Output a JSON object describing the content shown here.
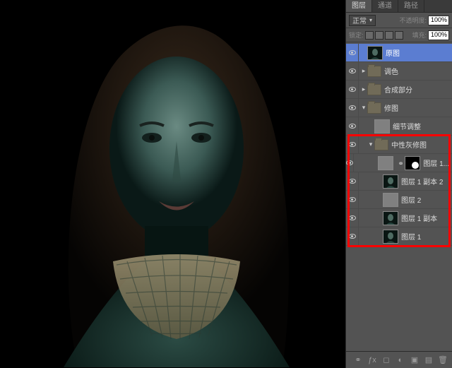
{
  "tabs": {
    "layers": "图层",
    "channels": "通道",
    "paths": "路径"
  },
  "toolbar": {
    "blend_mode": "正常",
    "opacity_label": "不透明度:",
    "opacity_value": "100%",
    "lock_label": "锁定:",
    "fill_label": "填充:",
    "fill_value": "100%"
  },
  "layers": [
    {
      "type": "layer",
      "selected": true,
      "label": "原图",
      "thumb": "portrait"
    },
    {
      "type": "group",
      "expanded": false,
      "label": "调色"
    },
    {
      "type": "group",
      "expanded": false,
      "label": "合成部分"
    },
    {
      "type": "group",
      "expanded": true,
      "label": "修图",
      "children": [
        {
          "type": "layer",
          "label": "细节调整",
          "thumb": "gray"
        },
        {
          "type": "group",
          "expanded": true,
          "label": "中性灰修图",
          "children": [
            {
              "type": "layer",
              "label": "图层 1...",
              "thumb": "gray",
              "mask": true
            },
            {
              "type": "layer",
              "label": "图层 1 副本 2",
              "thumb": "portrait-sm"
            },
            {
              "type": "layer",
              "label": "图层 2",
              "thumb": "gray"
            },
            {
              "type": "layer",
              "label": "图层 1 副本",
              "thumb": "portrait-sm"
            },
            {
              "type": "layer",
              "label": "图层 1",
              "thumb": "portrait-sm"
            }
          ]
        }
      ]
    }
  ],
  "footer_icons": [
    "fx-icon",
    "mask-icon",
    "adjust-icon",
    "group-icon",
    "new-layer-icon",
    "trash-icon"
  ]
}
